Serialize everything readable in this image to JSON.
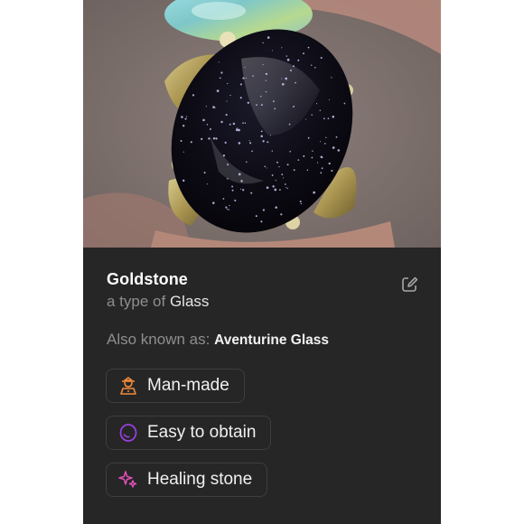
{
  "stone": {
    "name": "Goldstone",
    "type_prefix": "a type of",
    "type_name": "Glass",
    "aka_label": "Also known as:",
    "aka_value": "Aventurine Glass"
  },
  "tags": [
    {
      "label": "Man-made",
      "icon": "artisan-icon",
      "color": "#f08a3c"
    },
    {
      "label": "Easy to obtain",
      "icon": "stone-outline-icon",
      "color": "#9b3fe0"
    },
    {
      "label": "Healing stone",
      "icon": "sparkle-icon",
      "color": "#e04fb6"
    }
  ],
  "colors": {
    "background": "#262626",
    "text_primary": "#ffffff",
    "text_secondary": "#8e8e8e",
    "tag_border": "#3e3e3e"
  },
  "icons": {
    "edit": "edit-icon"
  }
}
